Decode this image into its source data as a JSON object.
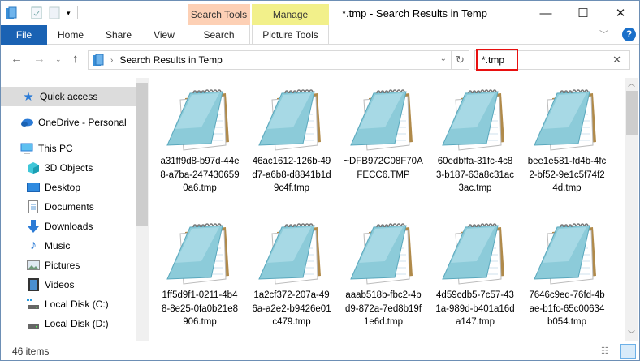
{
  "window": {
    "title": "*.tmp - Search Results in Temp"
  },
  "ribbon": {
    "context_groups": [
      {
        "label": "Search Tools",
        "color": "#fdd0b5"
      },
      {
        "label": "Manage",
        "color": "#f2f08a"
      }
    ],
    "tabs": [
      "File",
      "Home",
      "Share",
      "View",
      "Search",
      "Picture Tools"
    ],
    "accent": "#1a62b3"
  },
  "address": {
    "path": "Search Results in Temp"
  },
  "search": {
    "value": "*.tmp"
  },
  "sidebar": {
    "items": [
      {
        "label": "Quick access",
        "icon": "star-icon"
      },
      {
        "label": "OneDrive - Personal",
        "icon": "cloud-icon"
      },
      {
        "label": "This PC",
        "icon": "computer-icon"
      },
      {
        "label": "3D Objects",
        "icon": "cube-icon"
      },
      {
        "label": "Desktop",
        "icon": "desktop-icon"
      },
      {
        "label": "Documents",
        "icon": "document-icon"
      },
      {
        "label": "Downloads",
        "icon": "download-icon"
      },
      {
        "label": "Music",
        "icon": "music-icon"
      },
      {
        "label": "Pictures",
        "icon": "pictures-icon"
      },
      {
        "label": "Videos",
        "icon": "videos-icon"
      },
      {
        "label": "Local Disk (C:)",
        "icon": "drive-icon"
      },
      {
        "label": "Local Disk (D:)",
        "icon": "drive-icon"
      }
    ]
  },
  "files": [
    "a31ff9d8-b97d-44e8-a7ba-2474306590a6.tmp",
    "46ac1612-126b-49d7-a6b8-d8841b1d9c4f.tmp",
    "~DFB972C08F70AFECC6.TMP",
    "60edbffa-31fc-4c83-b187-63a8c31ac3ac.tmp",
    "bee1e581-fd4b-4fc2-bf52-9e1c5f74f24d.tmp",
    "1ff5d9f1-0211-4b48-8e25-0fa0b21e8906.tmp",
    "1a2cf372-207a-496a-a2e2-b9426e01c479.tmp",
    "aaab518b-fbc2-4bd9-872a-7ed8b19f1e6d.tmp",
    "4d59cdb5-7c57-431a-989d-b401a16da147.tmp",
    "7646c9ed-76fd-4bae-b1fc-65c00634b054.tmp"
  ],
  "status": {
    "item_count": "46 items"
  }
}
